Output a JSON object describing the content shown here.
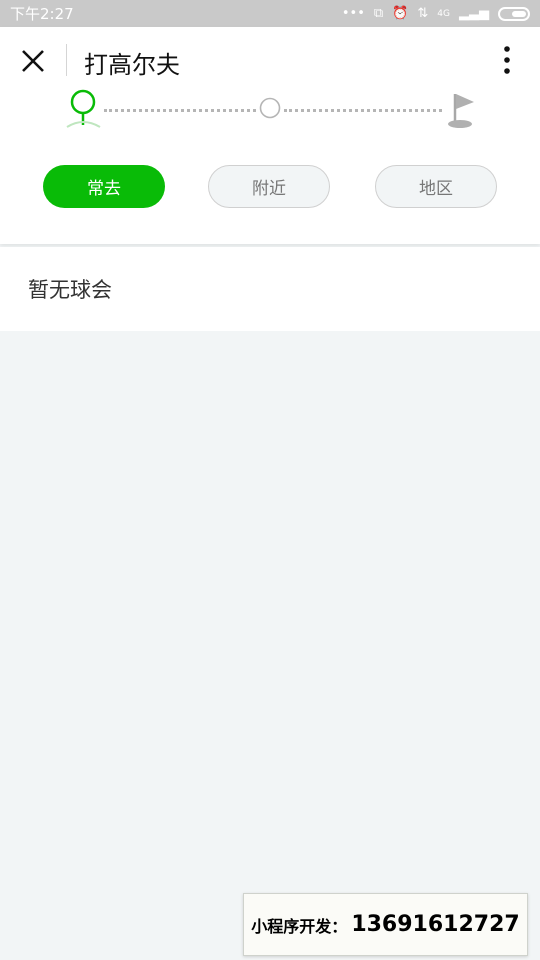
{
  "status_bar": {
    "time": "下午2:27",
    "network_label": "4G"
  },
  "navbar": {
    "title": "打高尔夫"
  },
  "steps": {
    "colors": {
      "active": "#09bb07",
      "inactive": "#b5b5b5"
    }
  },
  "tabs": [
    {
      "label": "常去",
      "active": true
    },
    {
      "label": "附近",
      "active": false
    },
    {
      "label": "地区",
      "active": false
    }
  ],
  "content": {
    "empty_text": "暂无球会"
  },
  "ad": {
    "label": "小程序开发：",
    "phone": "13691612727"
  },
  "colors": {
    "accent": "#09bb07",
    "background": "#f2f5f6",
    "status_bar": "#c9c9c9"
  }
}
